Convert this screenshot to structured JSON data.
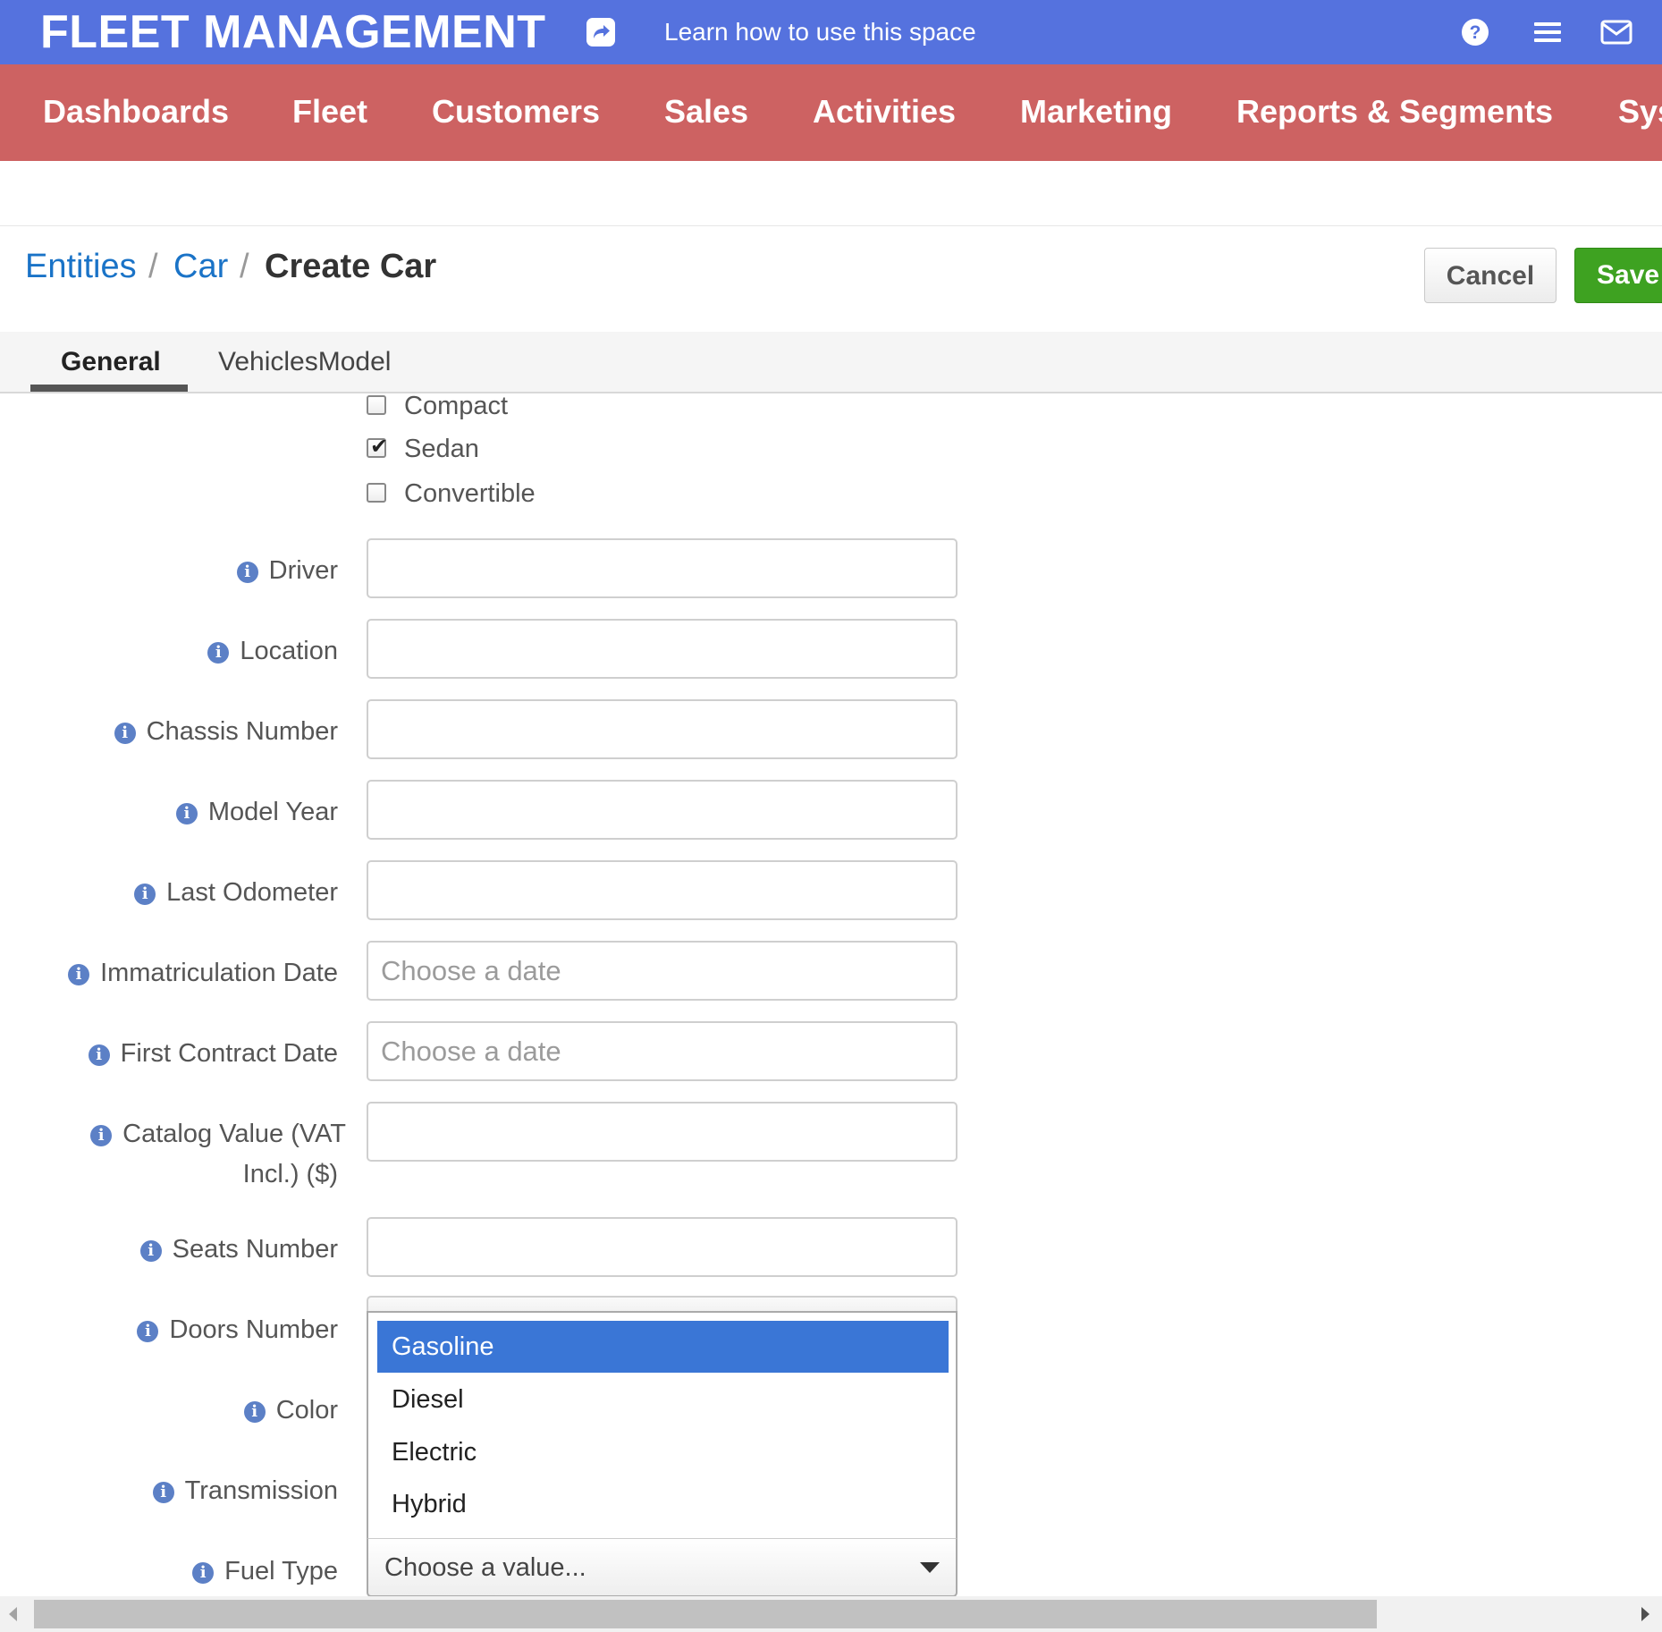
{
  "header": {
    "brand": "FLEET MANAGEMENT",
    "learn_link": "Learn how to use this space",
    "icons": [
      "share-icon",
      "help-icon",
      "menu-icon",
      "mail-icon"
    ]
  },
  "nav": {
    "items": [
      "Dashboards",
      "Fleet",
      "Customers",
      "Sales",
      "Activities",
      "Marketing",
      "Reports & Segments",
      "Sys"
    ]
  },
  "breadcrumb": {
    "entities": "Entities",
    "car": "Car",
    "sep": "/",
    "current": "Create Car"
  },
  "actions": {
    "cancel": "Cancel",
    "save": "Save"
  },
  "tabs": {
    "general": "General",
    "vehicles_model": "VehiclesModel"
  },
  "body_type_options": [
    {
      "label": "Compact",
      "checked": false
    },
    {
      "label": "Sedan",
      "checked": true
    },
    {
      "label": "Convertible",
      "checked": false
    }
  ],
  "fields": {
    "driver": {
      "label": "Driver",
      "value": ""
    },
    "location": {
      "label": "Location",
      "value": ""
    },
    "chassis_number": {
      "label": "Chassis Number",
      "value": ""
    },
    "model_year": {
      "label": "Model Year",
      "value": ""
    },
    "last_odometer": {
      "label": "Last Odometer",
      "value": ""
    },
    "immatriculation_date": {
      "label": "Immatriculation Date",
      "placeholder": "Choose a date"
    },
    "first_contract_date": {
      "label": "First Contract Date",
      "placeholder": "Choose a date"
    },
    "catalog_value": {
      "label_line1": "Catalog Value (VAT",
      "label_line2": "Incl.) ($)",
      "value": ""
    },
    "seats_number": {
      "label": "Seats Number",
      "value": ""
    },
    "doors_number": {
      "label": "Doors Number"
    },
    "color": {
      "label": "Color"
    },
    "transmission": {
      "label": "Transmission"
    },
    "fuel_type": {
      "label": "Fuel Type",
      "placeholder": "Choose a value..."
    }
  },
  "fuel_dropdown": {
    "options": [
      "Gasoline",
      "Diesel",
      "Electric",
      "Hybrid"
    ],
    "highlighted": "Gasoline"
  },
  "colors": {
    "topbar": "#5572de",
    "nav": "#cd6262",
    "link": "#1a73c7",
    "save": "#3ea221",
    "highlight": "#3a76d6"
  }
}
